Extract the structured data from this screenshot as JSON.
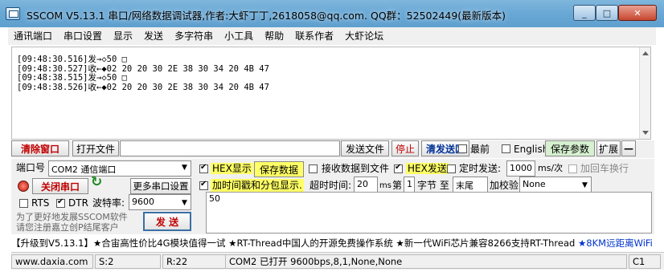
{
  "window": {
    "title": "SSCOM V5.13.1 串口/网络数据调试器,作者:大虾丁丁,2618058@qq.com. QQ群：52502449(最新版本)",
    "minimize_label": "_",
    "maximize_label": "□",
    "close_label": "✕"
  },
  "menu": [
    "通讯端口",
    "串口设置",
    "显示",
    "发送",
    "多字符串",
    "小工具",
    "帮助",
    "联系作者",
    "大虾论坛"
  ],
  "output": {
    "lines": [
      "[09:48:30.516]发→◇50 □",
      "[09:48:30.527]收←◆02 20 20 30 2E 38 30 34 20 4B 47",
      "[09:48:38.515]发→◇50 □",
      "[09:48:38.526]收←◆02 20 20 30 2E 38 30 34 20 4B 47"
    ]
  },
  "toolbar": {
    "clear_window": "清除窗口",
    "open_file": "打开文件",
    "file_path_value": "",
    "send_file": "发送文件",
    "stop": "停止",
    "clear_send": "清发送区",
    "front_most": "最前",
    "english": "English",
    "save_params": "保存参数",
    "expand": "扩展",
    "collapse": "—"
  },
  "panel": {
    "port_label": "端口号",
    "port_value": "COM2 通信端口",
    "close_port": "关闭串口",
    "more_settings": "更多串口设置",
    "rts": "RTS",
    "dtr": "DTR",
    "baud_label": "波特率:",
    "baud_value": "9600",
    "promo_line1": "为了更好地发展SSCOM软件",
    "promo_line2": "请您注册嘉立创P结尾客户",
    "send_button": "发  送",
    "hex_display": "HEX显示",
    "save_data": "保存数据",
    "recv_to_file": "接收数据到文件",
    "hex_send": "HEX发送",
    "timed_send": "定时发送:",
    "interval_value": "1000",
    "interval_unit": "ms/次",
    "add_crlf": "加回车换行",
    "timestamp": "加时间戳和分包显示.",
    "timeout_label": "超时时间:",
    "timeout_value": "20",
    "timeout_unit": "ms",
    "byte_prefix": "第",
    "byte_index": "1",
    "byte_middle": "字节 至",
    "byte_end": "末尾",
    "checksum_label": "加校验",
    "checksum_value": "None",
    "send_text": "50"
  },
  "ticker": {
    "text_black": "【升级到V5.13.1】★合宙高性价比4G模块值得一试 ★RT-Thread中国人的开源免费操作系统 ★新一代WiFi芯片兼容8266支持RT-Thread ",
    "text_blue": "★8KM远距离WiFi"
  },
  "status": {
    "website": "www.daxia.com",
    "sent": "S:2",
    "received": "R:22",
    "port_status": "COM2 已打开  9600bps,8,1,None,None",
    "counter": "C1"
  },
  "colors": {
    "title_bar": "#6aa9d6",
    "highlight_yellow": "#ffff66",
    "accent_red": "#c00000",
    "ticker_blue": "#0033cc"
  }
}
